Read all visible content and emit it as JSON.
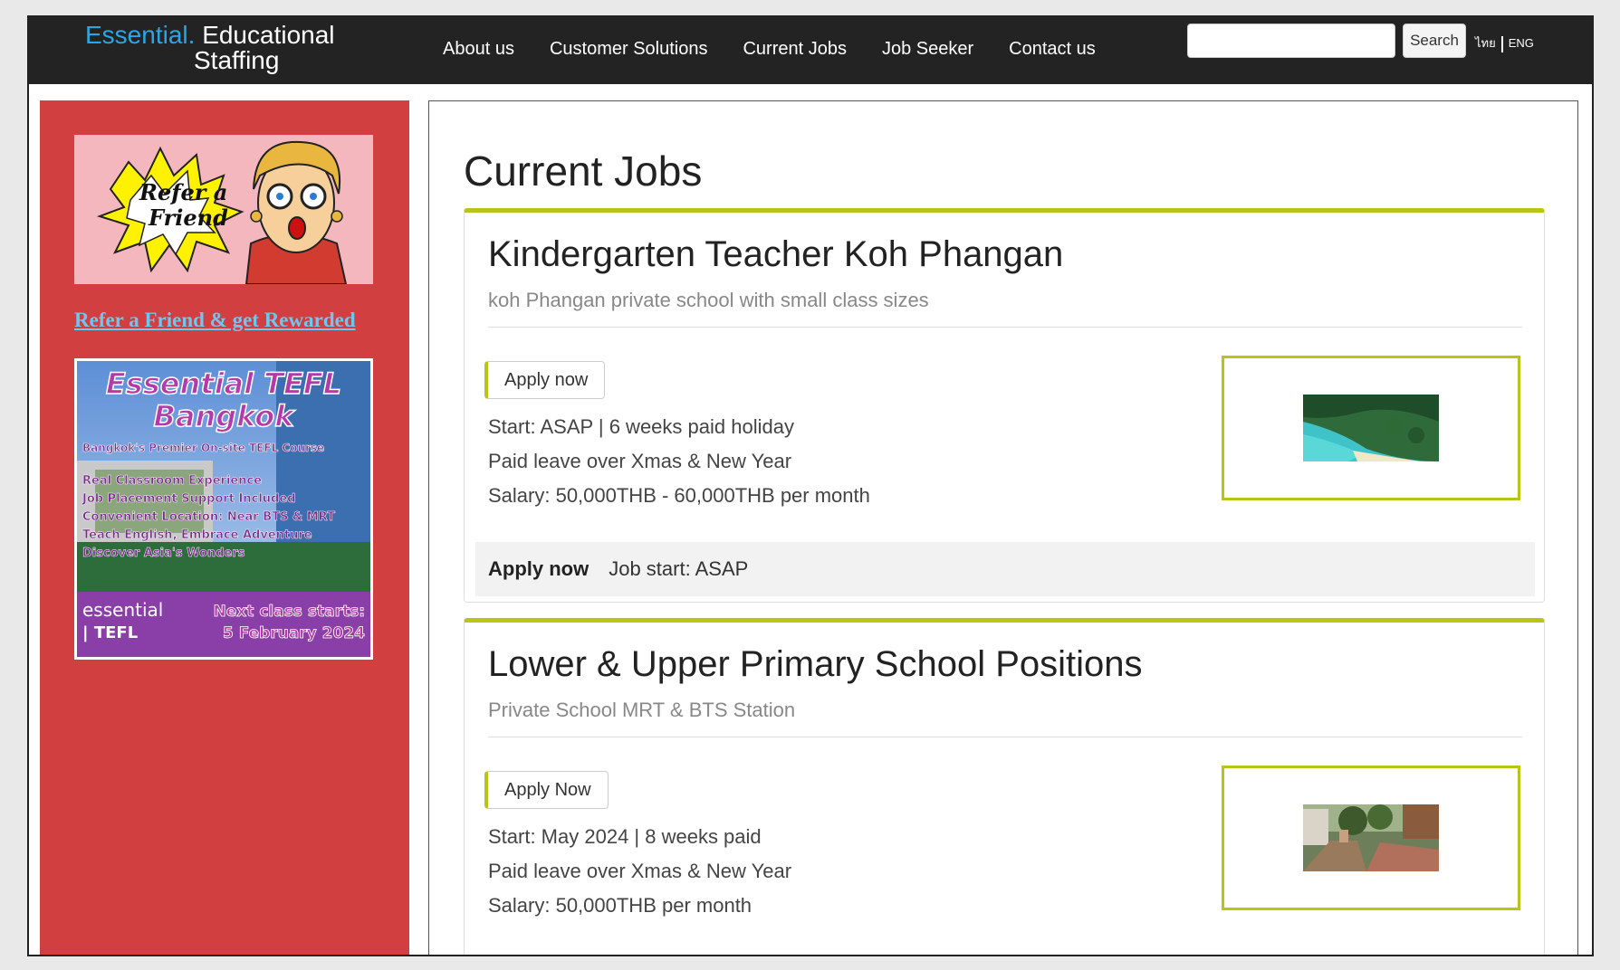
{
  "header": {
    "logo_brand": "Essential.",
    "logo_word1": "Educational",
    "logo_word2": "Staffing",
    "nav": [
      "About us",
      "Customer Solutions",
      "Current Jobs",
      "Job Seeker",
      "Contact us"
    ],
    "search_button": "Search",
    "search_placeholder": "",
    "lang_thai": "ไทย",
    "lang_eng": "ENG"
  },
  "sidebar": {
    "refer_link": "Refer a Friend & get Rewarded",
    "refer_banner": {
      "text1": "Refer a",
      "text2": "Friend"
    },
    "tefl_banner": {
      "title1": "Essential TEFL",
      "title2": "Bangkok",
      "tagline": "Bangkok's Premier On-site TEFL Course",
      "bullets": [
        "Real Classroom Experience",
        "Job Placement Support Included",
        "Convenient Location: Near BTS & MRT",
        "Teach English, Embrace Adventure",
        "Discover Asia's Wonders"
      ],
      "brand1": "essential",
      "brand2": "| TEFL",
      "next1": "Next class starts:",
      "next2": "5 February 2024"
    }
  },
  "main": {
    "title": "Current Jobs",
    "jobs": [
      {
        "title": "Kindergarten Teacher Koh Phangan",
        "subtitle": "koh Phangan private school with small class sizes",
        "apply_label": "Apply now",
        "lines": [
          "Start: ASAP | 6 weeks paid holiday",
          "Paid leave over Xmas & New Year",
          "Salary: 50,000THB - 60,000THB per month"
        ],
        "footer_apply": "Apply now",
        "footer_start": "Job start: ASAP"
      },
      {
        "title": "Lower & Upper Primary School Positions",
        "subtitle": "Private School MRT & BTS Station",
        "apply_label": "Apply Now",
        "lines": [
          "Start: May 2024 | 8 weeks paid",
          "Paid leave over Xmas & New Year",
          "Salary: 50,000THB per month"
        ]
      }
    ]
  },
  "colors": {
    "topbar": "#232323",
    "brand_blue": "#2aa6e8",
    "sidebar_red": "#d13f41",
    "accent_lime": "#b8c417",
    "link_blue": "#6ec7f0"
  }
}
